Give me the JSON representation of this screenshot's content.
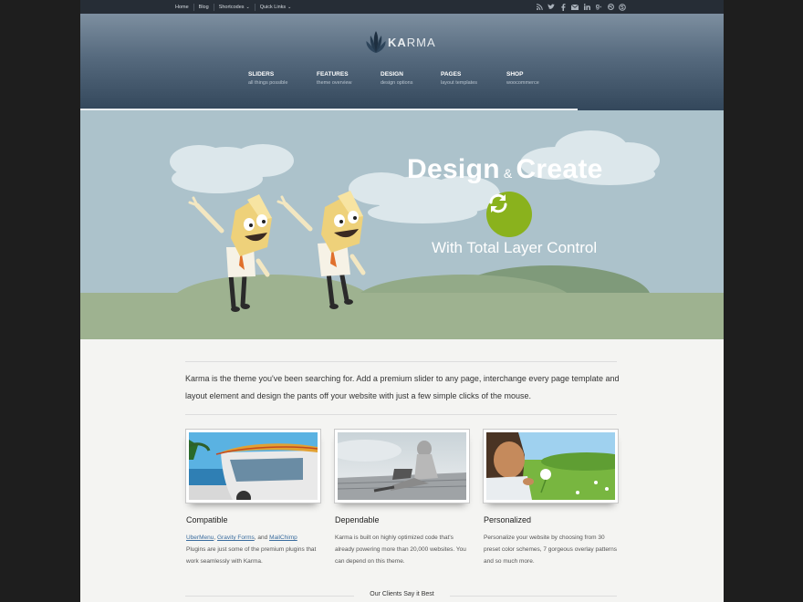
{
  "topbar": {
    "links": [
      "Home",
      "Blog",
      "Shortcodes",
      "Quick Links"
    ],
    "social_icons": [
      "rss-icon",
      "twitter-icon",
      "facebook-icon",
      "email-icon",
      "linkedin-icon",
      "google-plus-icon",
      "dribbble-icon",
      "skype-icon"
    ]
  },
  "header": {
    "logo_bold": "KA",
    "logo_rest": "RMA",
    "nav": [
      {
        "label": "SLIDERS",
        "sub": "all things possible"
      },
      {
        "label": "FEATURES",
        "sub": "theme overview"
      },
      {
        "label": "DESIGN",
        "sub": "design options"
      },
      {
        "label": "PAGES",
        "sub": "layout templates"
      },
      {
        "label": "SHOP",
        "sub": "woocommerce"
      }
    ]
  },
  "hero": {
    "title_left": "Design",
    "amp": "&",
    "title_right": "Create",
    "subtitle": "With Total Layer Control"
  },
  "intro": "Karma is the theme you've been searching for. Add a premium slider to any page, interchange every page template and layout element and design the pants off your website with just a few simple clicks of the mouse.",
  "features": [
    {
      "title": "Compatible",
      "link1": "UberMenu",
      "sep1": ", ",
      "link2": "Gravity Forms",
      "sep2": ", and ",
      "link3": "MailChimp",
      "text": "Plugins are just some of the premium plugins that work seamlessly with Karma."
    },
    {
      "title": "Dependable",
      "text": "Karma is built on highly optimized code that's already powering more than 20,000 websites. You can depend on this theme."
    },
    {
      "title": "Personalized",
      "text": "Personalize your website by choosing from 30 preset color schemes, 7 gorgeous overlay patterns and so much more."
    }
  ],
  "clients_heading": "Our Clients Say it Best",
  "colors": {
    "page_bg": "#1e1e1e",
    "content_bg": "#f4f4f2",
    "hero_sky": "#acc2cb",
    "hero_button": "#8ab21d",
    "link": "#3a6c9e"
  }
}
